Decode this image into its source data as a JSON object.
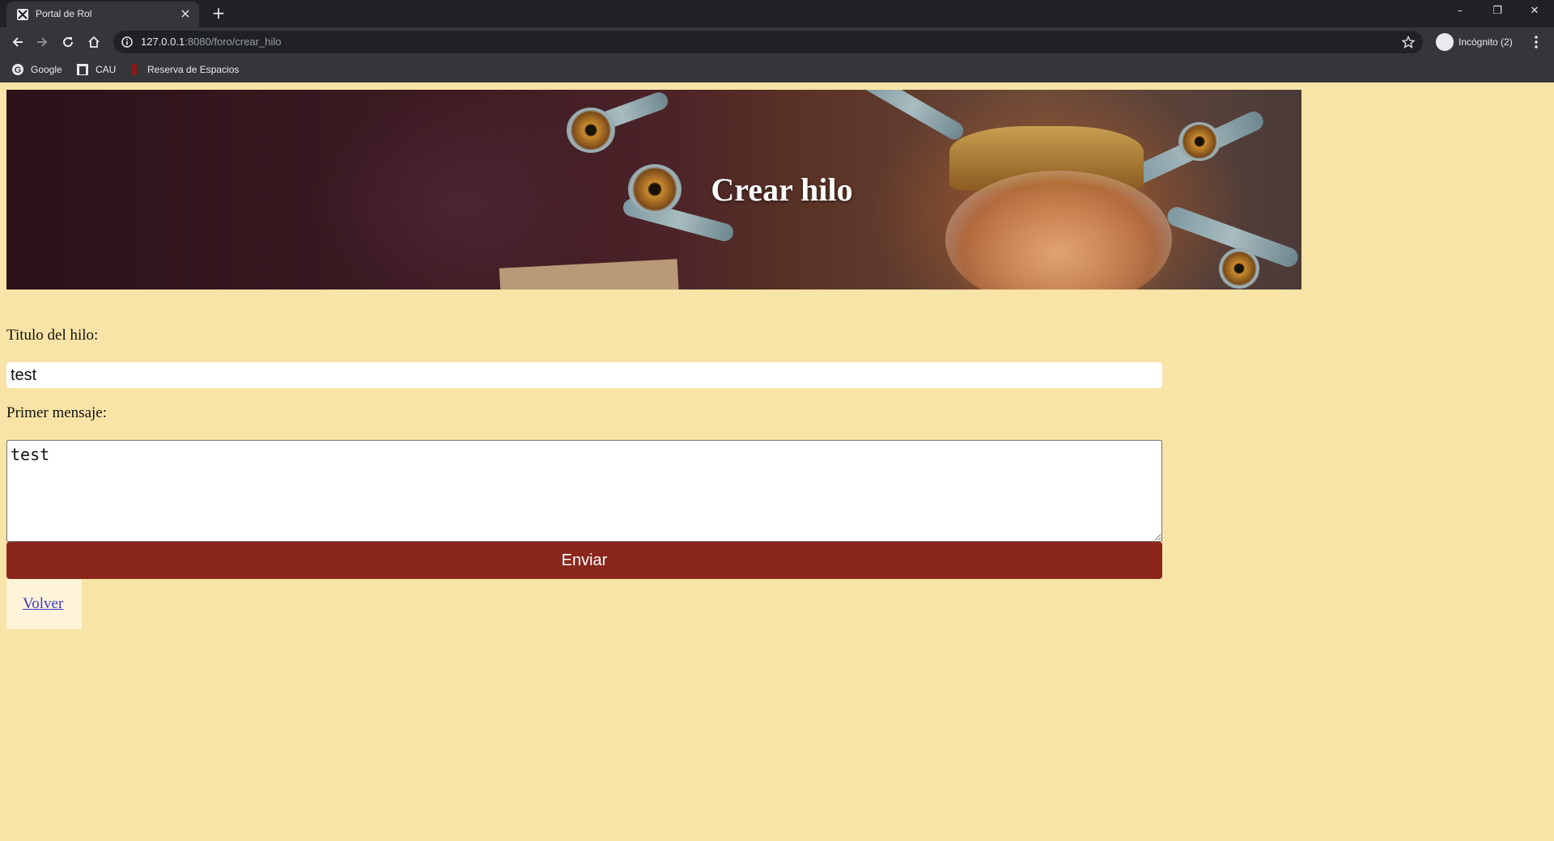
{
  "browser": {
    "tab_title": "Portal de Rol",
    "tab_close": "×",
    "new_tab": "+",
    "window_controls": {
      "minimize": "–",
      "restore": "❐",
      "close": "✕"
    },
    "url_host": "127.0.0.1",
    "url_path": ":8080/foro/crear_hilo",
    "profile_label": "Incógnito (2)",
    "bookmarks": [
      {
        "label": "Google",
        "icon": "google-icon"
      },
      {
        "label": "CAU",
        "icon": "cau-icon"
      },
      {
        "label": "Reserva de Espacios",
        "icon": "reserva-icon"
      }
    ]
  },
  "page": {
    "banner_title": "Crear hilo",
    "title_label": "Titulo del hilo:",
    "title_value": "test",
    "message_label": "Primer mensaje:",
    "message_value": "test",
    "send_label": "Enviar",
    "back_label": "Volver"
  },
  "colors": {
    "page_background": "#f8e4a6",
    "button": "#8a261c",
    "link": "#3a3ac8"
  }
}
